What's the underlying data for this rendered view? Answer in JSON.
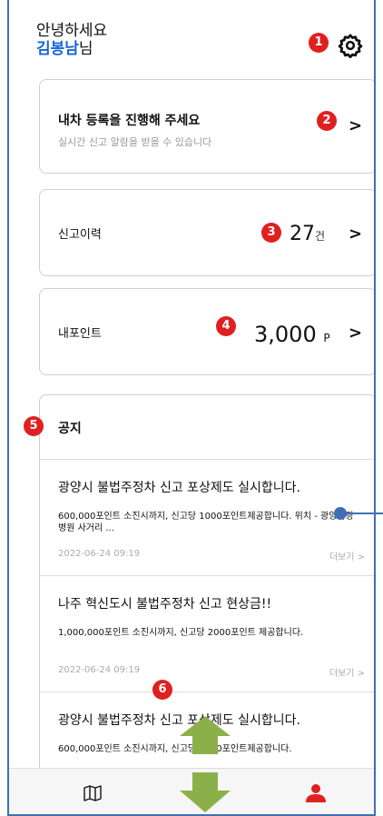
{
  "header": {
    "greeting": "안녕하세요",
    "user_name": "김봉남",
    "honorific": "님"
  },
  "car_card": {
    "title": "내차 등록을 진행해 주세요",
    "subtitle": "실시간 신고 알람을 받을 수 있습니다"
  },
  "report_card": {
    "label": "신고이력",
    "count": "27",
    "unit": "건"
  },
  "point_card": {
    "label": "내포인트",
    "amount": "3,000",
    "unit": "P"
  },
  "notice": {
    "title": "공지",
    "items": [
      {
        "title": "광양시 불법주정차 신고 포상제도 실시합니다.",
        "body": "600,000포인트 소진시까지, 신고당 1000포인트제공합니다. 위치 - 광양사랑병원 사거리 ...",
        "date": "2022-06-24 09:19",
        "more": "더보기 >"
      },
      {
        "title": "나주 혁신도시 불법주정차 신고 현상금!!",
        "body": "1,000,000포인트 소진시까지, 신고당 2000포인트 제공합니다.",
        "date": "2022-06-24 09:19",
        "more": "더보기 >"
      },
      {
        "title": "광양시 불법주정차 신고 포상제도 실시합니다.",
        "body": "600,000포인트 소진시까지, 신고당 1000포인트제공합니다."
      }
    ]
  },
  "chevron": ">",
  "badges": [
    "1",
    "2",
    "3",
    "4",
    "5",
    "6"
  ],
  "icons": {
    "settings": "gear-icon",
    "map": "map-icon",
    "profile": "person-icon"
  },
  "colors": {
    "accent_blue": "#1a66d9",
    "badge_red": "#e02020",
    "arrow_green": "#8bb04a",
    "person_red": "#e02020"
  }
}
